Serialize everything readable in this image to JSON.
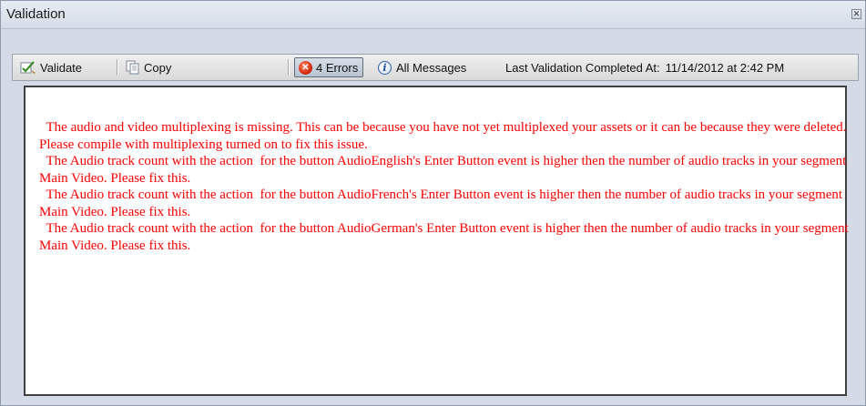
{
  "window": {
    "title": "Validation",
    "close_glyph": "✕"
  },
  "toolbar": {
    "validate_label": "Validate",
    "copy_label": "Copy",
    "errors_label": "4 Errors",
    "all_messages_label": "All Messages",
    "status_label": "Last Validation Completed At:",
    "status_value": "11/14/2012 at 2:42 PM"
  },
  "icons": {
    "validate": "validate-icon",
    "copy": "copy-icon",
    "errors": "error-icon",
    "info": "info-icon",
    "close": "close-icon"
  },
  "colors": {
    "message_text": "#ff0000",
    "error_icon": "#d62b10",
    "info_icon": "#2f5fa8"
  },
  "messages": [
    "  The audio and video multiplexing is missing. This can be because you have not yet multiplexed your assets or it can be because they were deleted. Please compile with multiplexing turned on to fix this issue.",
    "  The Audio track count with the action  for the button AudioEnglish's Enter Button event is higher then the number of audio tracks in your segment Main Video. Please fix this.",
    "  The Audio track count with the action  for the button AudioFrench's Enter Button event is higher then the number of audio tracks in your segment Main Video. Please fix this.",
    "  The Audio track count with the action  for the button AudioGerman's Enter Button event is higher then the number of audio tracks in your segment Main Video. Please fix this."
  ]
}
